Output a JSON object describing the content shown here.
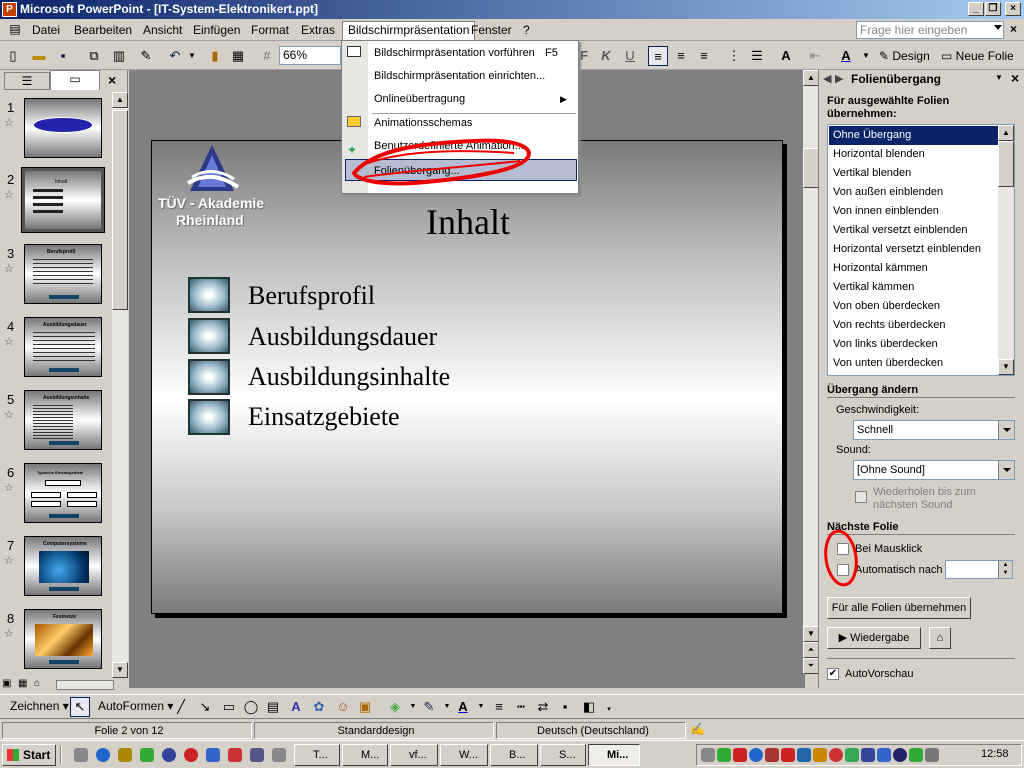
{
  "window": {
    "title": "Microsoft PowerPoint - [IT-System-Elektronikert.ppt]",
    "app_icon": "P"
  },
  "menubar": {
    "items": [
      "Datei",
      "Bearbeiten",
      "Ansicht",
      "Einfügen",
      "Format",
      "Extras",
      "Bildschirmpräsentation",
      "Fenster",
      "?"
    ],
    "help_placeholder": "Frage hier eingeben"
  },
  "toolbar": {
    "zoom": "66%",
    "design_label": "Design",
    "new_slide_label": "Neue Folie"
  },
  "dropdown": {
    "items": [
      {
        "label": "Bildschirmpräsentation vorführen",
        "shortcut": "F5"
      },
      {
        "label": "Bildschirmpräsentation einrichten...",
        "shortcut": ""
      },
      {
        "label": "Onlineübertragung",
        "shortcut": "▶"
      },
      {
        "label": "Animationsschemas",
        "shortcut": ""
      },
      {
        "label": "Benutzerdefinierte Animation...",
        "shortcut": ""
      },
      {
        "label": "Folienübergang...",
        "shortcut": ""
      }
    ]
  },
  "slides_pane": {
    "thumbnails": [
      {
        "num": "1",
        "title": ""
      },
      {
        "num": "2",
        "title": "Inhalt"
      },
      {
        "num": "3",
        "title": "Berufsprofil"
      },
      {
        "num": "4",
        "title": "Ausbildungsdauer"
      },
      {
        "num": "5",
        "title": "Ausbildungsinhalte"
      },
      {
        "num": "6",
        "title": "Typische Einsatzgebiete"
      },
      {
        "num": "7",
        "title": "Computersysteme"
      },
      {
        "num": "8",
        "title": "Festnetze"
      }
    ]
  },
  "slide": {
    "logo_line1": "TÜV - Akademie",
    "logo_line2": "Rheinland",
    "title": "Inhalt",
    "bullets": [
      "Berufsprofil",
      "Ausbildungsdauer",
      "Ausbildungsinhalte",
      "Einsatzgebiete"
    ]
  },
  "taskpane": {
    "title": "Folienübergang",
    "apply_header": "Für ausgewählte Folien übernehmen:",
    "transitions": [
      "Ohne Übergang",
      "Horizontal blenden",
      "Vertikal blenden",
      "Von außen einblenden",
      "Von innen einblenden",
      "Vertikal versetzt einblenden",
      "Horizontal versetzt einblenden",
      "Horizontal kämmen",
      "Vertikal kämmen",
      "Von oben überdecken",
      "Von rechts überdecken",
      "Von links überdecken",
      "Von unten überdecken"
    ],
    "change_header": "Übergang ändern",
    "speed_label": "Geschwindigkeit:",
    "speed_value": "Schnell",
    "sound_label": "Sound:",
    "sound_value": "[Ohne Sound]",
    "repeat_label": "Wiederholen bis zum nächsten Sound",
    "next_header": "Nächste Folie",
    "on_click_label": "Bei Mausklick",
    "auto_label": "Automatisch nach",
    "apply_all_button": "Für alle Folien übernehmen",
    "play_button": "Wiedergabe",
    "autopreview_label": "AutoVorschau"
  },
  "drawbar": {
    "draw_label": "Zeichnen",
    "autoshapes_label": "AutoFormen"
  },
  "statusbar": {
    "slide_info": "Folie 2 von 12",
    "design": "Standarddesign",
    "language": "Deutsch (Deutschland)"
  },
  "taskbar": {
    "start_label": "Start",
    "tasks": [
      "T...",
      "M...",
      "vf...",
      "W...",
      "B...",
      "S...",
      "Mi..."
    ],
    "clock": "12:58"
  }
}
